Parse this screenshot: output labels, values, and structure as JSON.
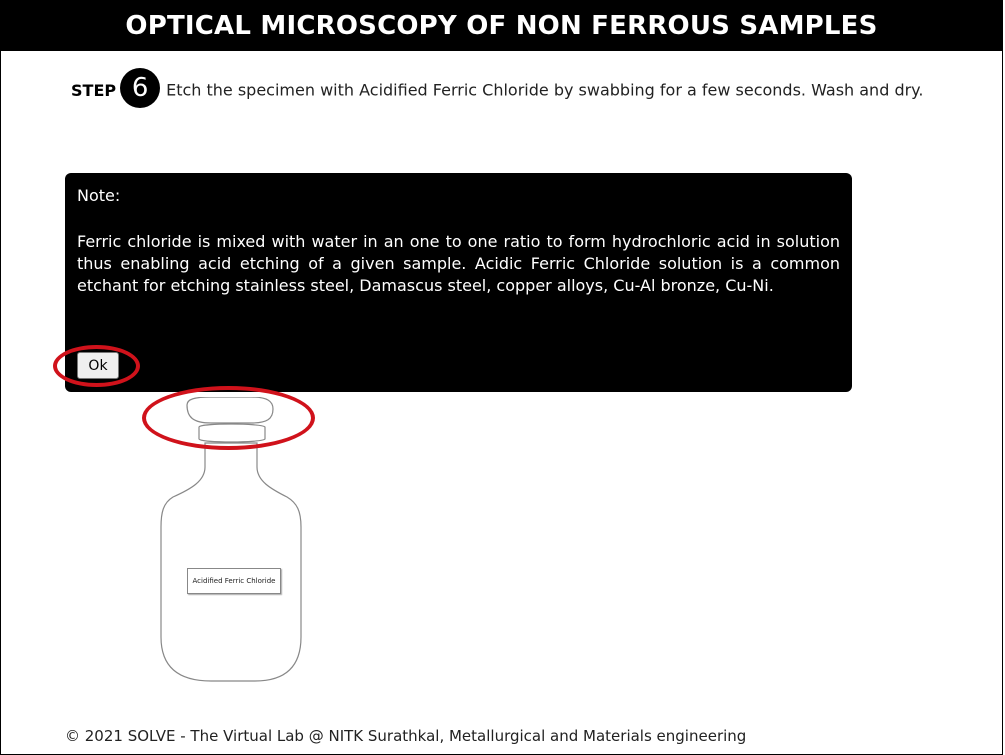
{
  "header": {
    "title": "OPTICAL MICROSCOPY OF NON FERROUS SAMPLES"
  },
  "step": {
    "label": "STEP",
    "number": "6",
    "instruction": "Etch the specimen with Acidified Ferric Chloride by swabbing for a few seconds. Wash and dry."
  },
  "note": {
    "title": "Note:",
    "body": "Ferric chloride is mixed with water in an one to one ratio to form hydrochloric acid in solution thus enabling acid etching of a given sample. Acidic Ferric Chloride solution is a common etchant for etching stainless steel, Damascus steel, copper alloys, Cu-Al bronze, Cu-Ni.",
    "ok_label": "Ok"
  },
  "bottle": {
    "label": "Acidified Ferric Chloride"
  },
  "footer": {
    "text": "© 2021 SOLVE - The Virtual Lab @ NITK Surathkal, Metallurgical and Materials engineering"
  },
  "colors": {
    "header_bg": "#000000",
    "note_bg": "#000000",
    "highlight": "#d0121b"
  }
}
